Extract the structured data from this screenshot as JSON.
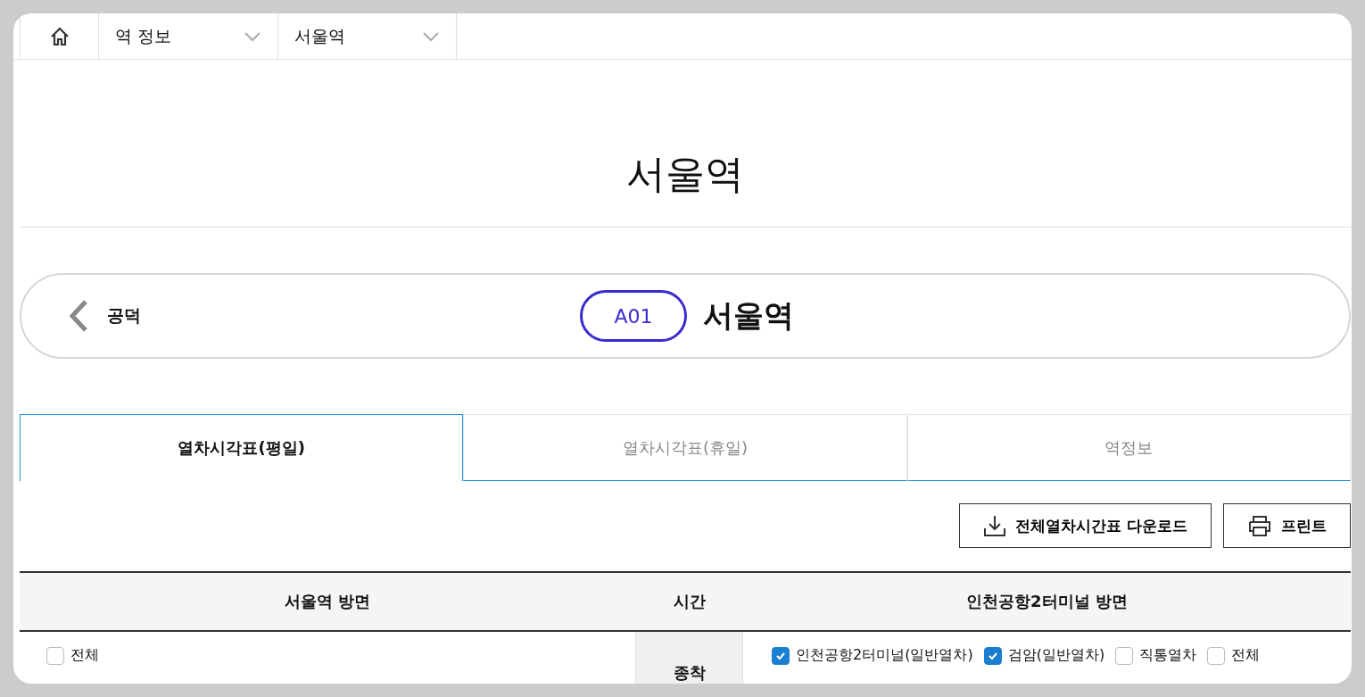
{
  "breadcrumb": [
    {
      "label": "역 정보"
    },
    {
      "label": "서울역"
    }
  ],
  "page_title": "서울역",
  "station_nav": {
    "prev_label": "공덕",
    "code": "A01",
    "name": "서울역"
  },
  "tabs": [
    {
      "label": "열차시각표(평일)",
      "selected": true
    },
    {
      "label": "열차시각표(휴일)",
      "selected": false
    },
    {
      "label": "역정보",
      "selected": false
    }
  ],
  "actions": [
    {
      "kind": "download",
      "label": "전체열차시간표 다운로드"
    },
    {
      "kind": "print",
      "label": "프린트"
    }
  ],
  "table": {
    "columns": [
      "서울역 방면",
      "시간",
      "인천공항2터미널 방면"
    ],
    "left_filters": [
      {
        "label": "전체",
        "checked": false
      }
    ],
    "time_cell": "종착",
    "right_filters": [
      {
        "label": "인천공항2터미널(일반열차)",
        "checked": true
      },
      {
        "label": "검암(일반열차)",
        "checked": true
      },
      {
        "label": "직통열차",
        "checked": false
      },
      {
        "label": "전체",
        "checked": false
      }
    ]
  }
}
